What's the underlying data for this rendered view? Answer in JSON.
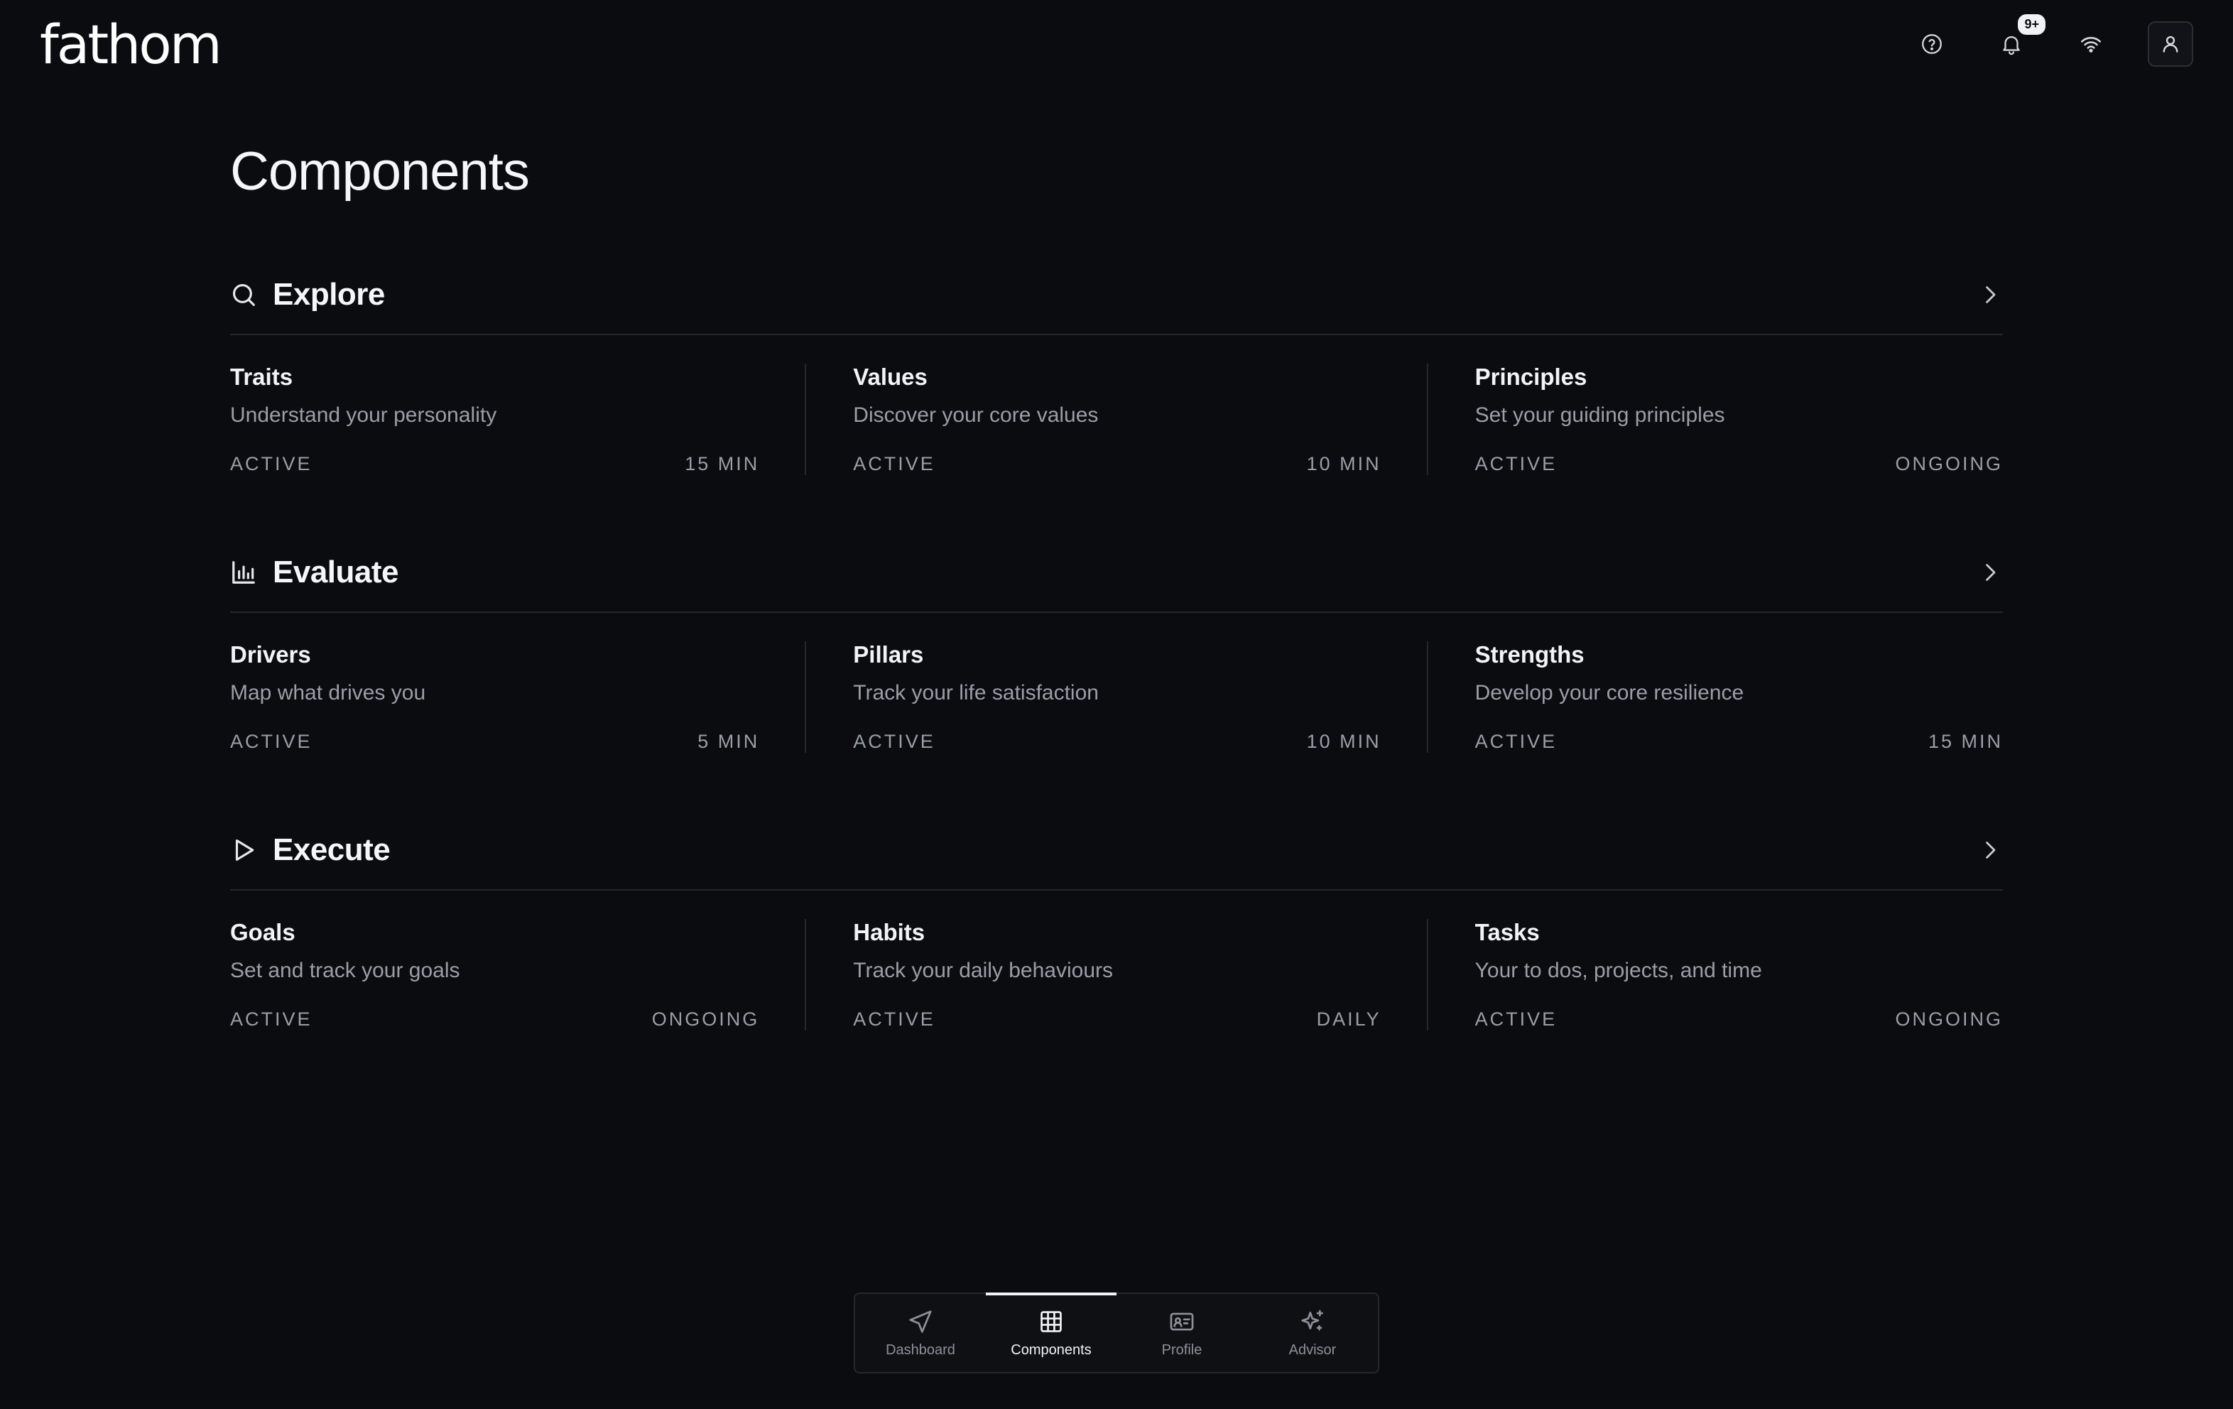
{
  "app": {
    "logo_text": "fathom",
    "notifications_badge": "9+"
  },
  "page": {
    "title": "Components"
  },
  "sections": [
    {
      "title": "Explore",
      "icon": "search-icon",
      "cards": [
        {
          "name": "Traits",
          "description": "Understand your personality",
          "status": "ACTIVE",
          "duration": "15 MIN"
        },
        {
          "name": "Values",
          "description": "Discover your core values",
          "status": "ACTIVE",
          "duration": "10 MIN"
        },
        {
          "name": "Principles",
          "description": "Set your guiding principles",
          "status": "ACTIVE",
          "duration": "ONGOING"
        }
      ]
    },
    {
      "title": "Evaluate",
      "icon": "bar-chart-icon",
      "cards": [
        {
          "name": "Drivers",
          "description": "Map what drives you",
          "status": "ACTIVE",
          "duration": "5 MIN"
        },
        {
          "name": "Pillars",
          "description": "Track your life satisfaction",
          "status": "ACTIVE",
          "duration": "10 MIN"
        },
        {
          "name": "Strengths",
          "description": "Develop your core resilience",
          "status": "ACTIVE",
          "duration": "15 MIN"
        }
      ]
    },
    {
      "title": "Execute",
      "icon": "play-icon",
      "cards": [
        {
          "name": "Goals",
          "description": "Set and track your goals",
          "status": "ACTIVE",
          "duration": "ONGOING"
        },
        {
          "name": "Habits",
          "description": "Track your daily behaviours",
          "status": "ACTIVE",
          "duration": "DAILY"
        },
        {
          "name": "Tasks",
          "description": "Your to dos, projects, and time",
          "status": "ACTIVE",
          "duration": "ONGOING"
        }
      ]
    }
  ],
  "bottom_nav": {
    "items": [
      {
        "label": "Dashboard",
        "icon": "navigation-arrow-icon",
        "active": false
      },
      {
        "label": "Components",
        "icon": "grid-icon",
        "active": true
      },
      {
        "label": "Profile",
        "icon": "id-card-icon",
        "active": false
      },
      {
        "label": "Advisor",
        "icon": "sparkles-icon",
        "active": false
      }
    ]
  },
  "colors": {
    "background": "#0b0c10",
    "text_primary": "#f1f2f4",
    "text_muted": "#9a9ea7",
    "divider": "#24272e"
  }
}
